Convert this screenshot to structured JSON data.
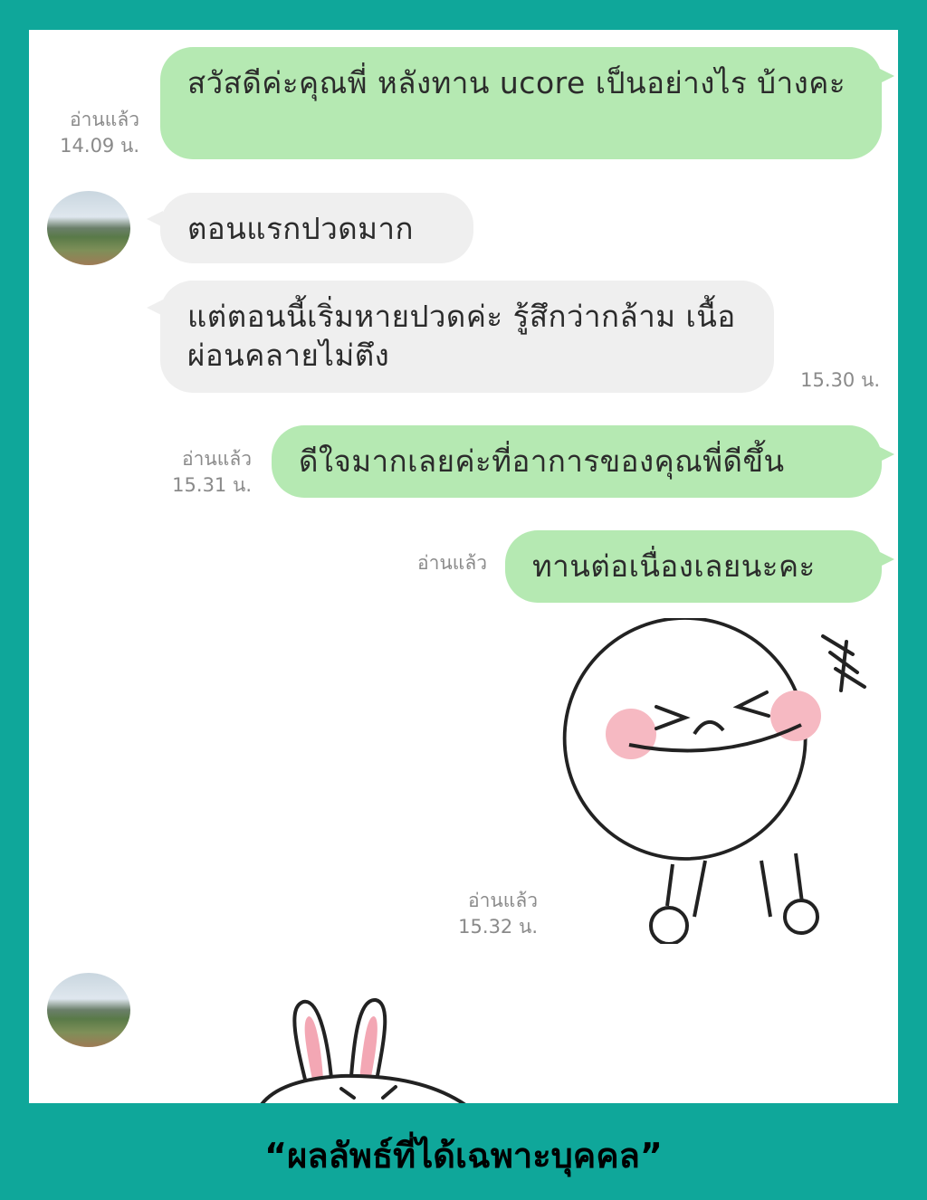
{
  "messages": [
    {
      "text": "สวัสดีค่ะคุณพี่ หลังทาน ucore เป็นอย่างไร บ้างคะ",
      "read": "อ่านแล้ว",
      "time": "14.09 น."
    },
    {
      "text": "ตอนแรกปวดมาก"
    },
    {
      "text": "แต่ตอนนี้เริ่มหายปวดค่ะ รู้สึกว่ากล้าม เนื้อผ่อนคลายไม่ตึง",
      "time": "15.30 น."
    },
    {
      "text": "ดีใจมากเลยค่ะที่อาการของคุณพี่ดีขึ้น",
      "read": "อ่านแล้ว",
      "time": "15.31 น."
    },
    {
      "text": "ทานต่อเนื่องเลยนะคะ",
      "read": "อ่านแล้ว"
    },
    {
      "read": "อ่านแล้ว",
      "time": "15.32 น."
    }
  ],
  "stickers": {
    "outgoing": "laughing-round-face-sticker",
    "incoming": "bunny-sticker"
  },
  "caption": "“ผลลัพธ์ที่ได้เฉพาะบุคคล”",
  "colors": {
    "frame": "#0fa79a",
    "outgoing_bubble": "#b5e9b2",
    "incoming_bubble": "#efefef",
    "meta_text": "#8a8a8a"
  }
}
